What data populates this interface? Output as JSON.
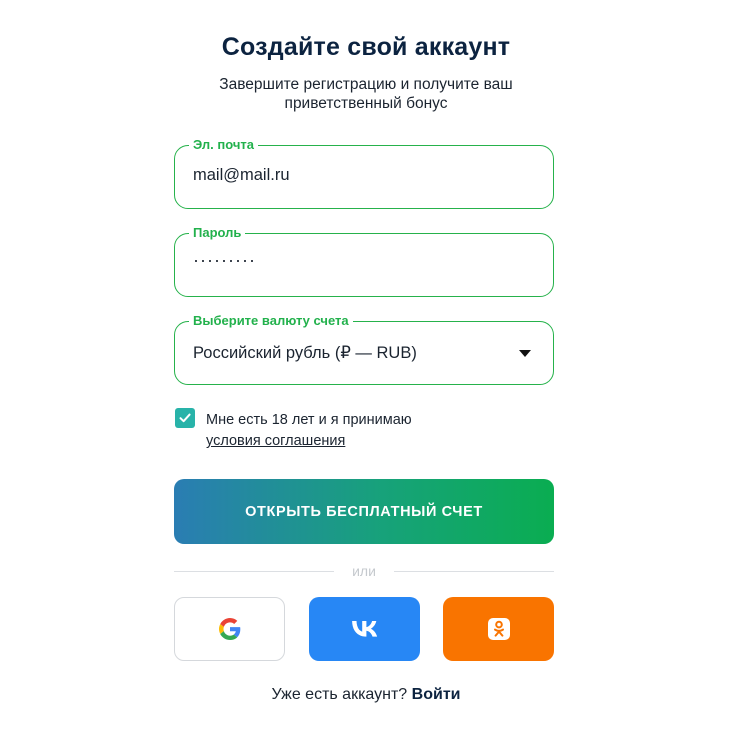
{
  "header": {
    "title": "Создайте свой аккаунт",
    "subtitle": "Завершите регистрацию и получите ваш приветственный бонус"
  },
  "form": {
    "email": {
      "label": "Эл. почта",
      "value": "mail@mail.ru"
    },
    "password": {
      "label": "Пароль",
      "value": "·········"
    },
    "currency": {
      "label": "Выберите валюту счета",
      "selected": "Российский рубль (₽ — RUB)"
    },
    "agreement": {
      "text": "Мне есть 18 лет и я принимаю",
      "link": "условия соглашения",
      "checked": true
    },
    "submit_label": "ОТКРЫТЬ БЕСПЛАТНЫЙ СЧЕТ",
    "divider_text": "или"
  },
  "social": {
    "google": {
      "icon": "google-icon",
      "color": "#ffffff"
    },
    "vk": {
      "icon": "vk-icon",
      "color": "#2787f5"
    },
    "ok": {
      "icon": "odnoklassniki-icon",
      "color": "#f97400"
    }
  },
  "footer": {
    "question": "Уже есть аккаунт?",
    "login_label": "Войти"
  },
  "colors": {
    "accent_green": "#26b24b",
    "checkbox": "#28b3a9",
    "title": "#0c2340"
  }
}
